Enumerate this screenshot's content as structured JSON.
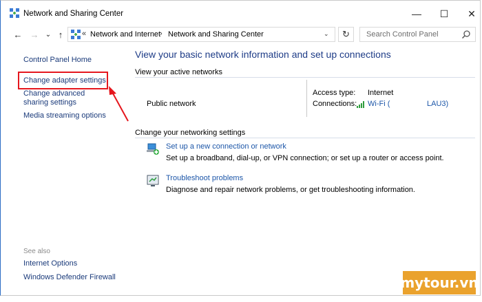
{
  "window": {
    "title": "Network and Sharing Center"
  },
  "titlebar_buttons": {
    "minimize": "—",
    "maximize": "☐",
    "close": "✕"
  },
  "nav": {
    "back": "←",
    "forward": "→",
    "recent": "⌄",
    "up": "↑"
  },
  "address": {
    "overflow": "«",
    "crumbs": [
      "Network and Internet",
      "Network and Sharing Center"
    ],
    "separator": "›",
    "dropdown": "⌄",
    "refresh": "↻"
  },
  "search": {
    "placeholder": "Search Control Panel"
  },
  "sidebar": {
    "home": "Control Panel Home",
    "items": [
      "Change adapter settings",
      "Change advanced sharing settings",
      "Media streaming options"
    ],
    "see_also_label": "See also",
    "see_also": [
      "Internet Options",
      "Windows Defender Firewall"
    ]
  },
  "main": {
    "heading": "View your basic network information and set up connections",
    "active_networks_label": "View your active networks",
    "network_name": "Public network",
    "access_type_label": "Access type:",
    "access_type_value": "Internet",
    "connections_label": "Connections:",
    "connection_value": "Wi-Fi (",
    "connection_value_end": "LAU3)",
    "change_settings_label": "Change your networking settings",
    "tasks": [
      {
        "title": "Set up a new connection or network",
        "desc": "Set up a broadband, dial-up, or VPN connection; or set up a router or access point.",
        "icon": "network-setup-icon"
      },
      {
        "title": "Troubleshoot problems",
        "desc": "Diagnose and repair network problems, or get troubleshooting information.",
        "icon": "troubleshoot-icon"
      }
    ]
  },
  "watermark": {
    "text": "mytour.vn"
  },
  "colors": {
    "highlight": "#e5161d",
    "link": "#1c56a8",
    "heading": "#1e3c87",
    "watermark_bg": "#eaa22d"
  }
}
